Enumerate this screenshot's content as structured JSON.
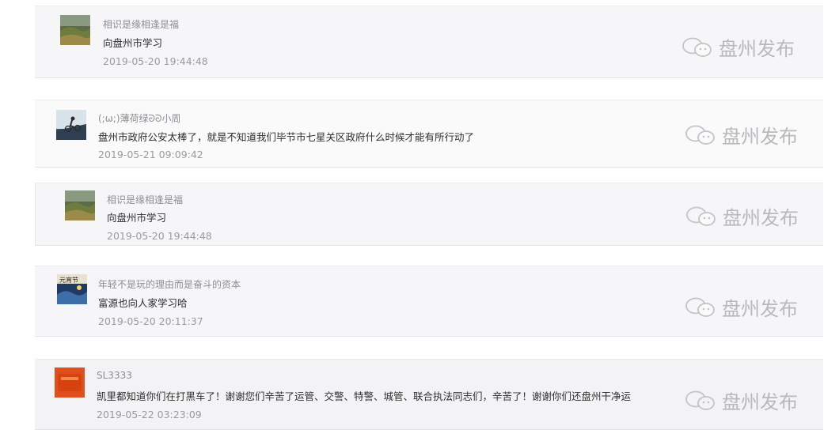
{
  "watermark": "盘州发布",
  "comments": [
    {
      "nickname": "相识是缘相逢是福",
      "text": "向盘州市学习",
      "time": "2019-05-20 19:44:48",
      "avatar_icon": "landscape-avatar-icon"
    },
    {
      "nickname": "(;ω;)薄荷绿ᘐᘐ小周",
      "text": "盘州市政府公安太棒了，就是不知道我们毕节市七星关区政府什么时候才能有所行动了",
      "time": "2019-05-21 09:09:42",
      "avatar_icon": "cyclist-avatar-icon"
    },
    {
      "nickname": "相识是缘相逢是福",
      "text": "向盘州市学习",
      "time": "2019-05-20 19:44:48",
      "avatar_icon": "landscape-avatar-icon"
    },
    {
      "nickname": "年轻不是玩的理由而是奋斗的资本",
      "text": "富源也向人家学习哈",
      "time": "2019-05-20 20:11:37",
      "avatar_icon": "poster-avatar-icon"
    },
    {
      "nickname": "SL3333",
      "text": "凯里都知道你们在打黑车了！谢谢您们辛苦了运管、交警、特警、城管、联合执法同志们，辛苦了！谢谢你们还盘州干净运",
      "time": "2019-05-22 03:23:09",
      "avatar_icon": "orange-avatar-icon"
    }
  ]
}
